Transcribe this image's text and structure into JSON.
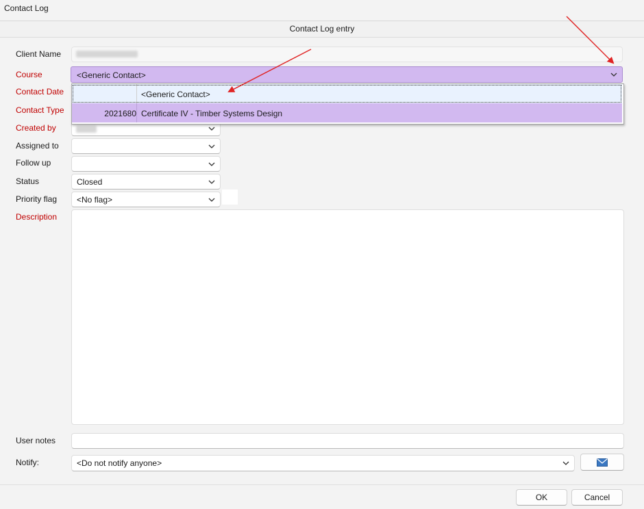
{
  "window": {
    "title": "Contact Log"
  },
  "section": {
    "title": "Contact Log entry"
  },
  "labels": {
    "client_name": "Client Name",
    "course": "Course",
    "contact_date": "Contact Date",
    "contact_type": "Contact Type",
    "created_by": "Created by",
    "assigned_to": "Assigned to",
    "follow_up": "Follow up",
    "status": "Status",
    "priority_flag": "Priority flag",
    "description": "Description",
    "user_notes": "User notes",
    "notify": "Notify:"
  },
  "fields": {
    "course_value": "<Generic Contact>",
    "assigned_to_value": "",
    "follow_up_value": "",
    "status_value": "Closed",
    "priority_flag_value": "<No flag>",
    "user_notes_value": "",
    "notify_value": "<Do not notify anyone>"
  },
  "course_dropdown": {
    "options": [
      {
        "code": "",
        "name": "<Generic Contact>",
        "selected": true
      },
      {
        "code": "2021680",
        "name": "Certificate IV - Timber Systems Design",
        "highlighted": true
      }
    ]
  },
  "buttons": {
    "ok": "OK",
    "cancel": "Cancel"
  },
  "icons": {
    "email": "envelope-icon",
    "dropdown": "chevron-down-icon"
  },
  "colors": {
    "course_highlight": "#d2b9f0",
    "required_label": "#c00000",
    "annotation_arrow": "#e02424"
  }
}
